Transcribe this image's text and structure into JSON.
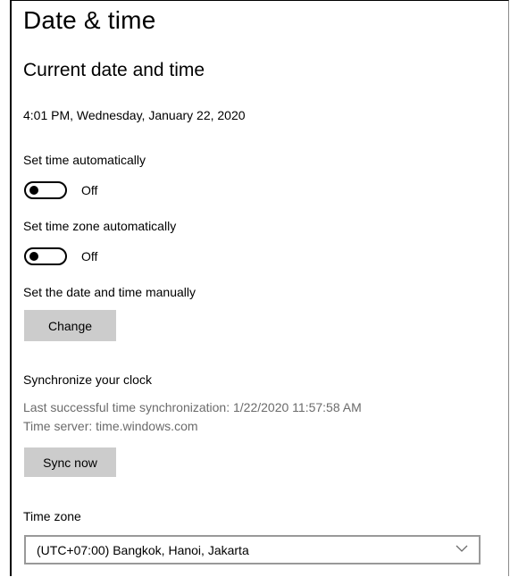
{
  "page": {
    "title": "Date & time"
  },
  "current": {
    "heading": "Current date and time",
    "value": "4:01 PM, Wednesday, January 22, 2020"
  },
  "set_time_auto": {
    "label": "Set time automatically",
    "state": "Off",
    "on": false
  },
  "set_timezone_auto": {
    "label": "Set time zone automatically",
    "state": "Off",
    "on": false
  },
  "manual": {
    "label": "Set the date and time manually",
    "button_label": "Change"
  },
  "sync": {
    "label": "Synchronize your clock",
    "last_sync": "Last successful time synchronization: 1/22/2020 11:57:58 AM",
    "server": "Time server: time.windows.com",
    "button_label": "Sync now"
  },
  "timezone": {
    "label": "Time zone",
    "selected": "(UTC+07:00) Bangkok, Hanoi, Jakarta",
    "icon": "chevron-down-icon"
  },
  "colors": {
    "button_bg": "#cccccc",
    "secondary_text": "#6b6b6b",
    "select_border": "#999999"
  }
}
